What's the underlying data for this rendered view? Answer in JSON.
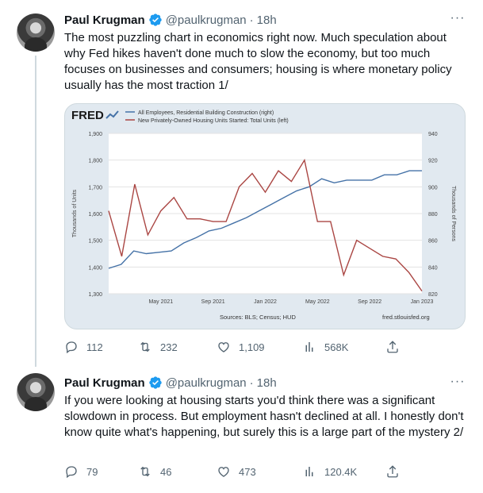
{
  "tweets": [
    {
      "author": {
        "name": "Paul Krugman",
        "handle": "@paulkrugman",
        "separator": "·",
        "time": "18h"
      },
      "text": "The most puzzling chart in economics right now. Much speculation about why Fed hikes haven't done much to slow the economy, but too much focuses on businesses and consumers; housing is where monetary policy usually has the most traction 1/",
      "more_icon": "···",
      "stats": {
        "replies": "112",
        "retweets": "232",
        "likes": "1,109",
        "views": "568K"
      }
    },
    {
      "author": {
        "name": "Paul Krugman",
        "handle": "@paulkrugman",
        "separator": "·",
        "time": "18h"
      },
      "text": "If you were looking at housing starts you'd think there was a significant slowdown in process. But employment hasn't declined at all. I honestly don't know quite what's happening, but surely this is a large part of the mystery 2/",
      "more_icon": "···",
      "stats": {
        "replies": "79",
        "retweets": "46",
        "likes": "473",
        "views": "120.4K"
      }
    }
  ],
  "icons": [
    "verified-badge-icon",
    "more-icon",
    "reply-icon",
    "retweet-icon",
    "like-icon",
    "views-icon",
    "share-icon"
  ],
  "colors": {
    "verified": "#1d9bf0",
    "text": "#0f1419",
    "muted": "#536471",
    "fred_blue": "#4572a7",
    "fred_red": "#aa4643",
    "chart_bg": "#e1e9f0"
  },
  "chart_data": {
    "type": "line",
    "logo": "FRED",
    "legend": [
      "All Employees, Residential Building Construction (right)",
      "New Privately-Owned Housing Units Started: Total Units (left)"
    ],
    "ylabel_left": "Thousands of Units",
    "ylabel_right": "Thousands of Persons",
    "ylim_left": [
      1300,
      1900
    ],
    "ylim_right": [
      820,
      940
    ],
    "yticks_left": [
      "1,900",
      "1,800",
      "1,700",
      "1,600",
      "1,500",
      "1,400",
      "1,300"
    ],
    "yticks_right": [
      "940",
      "920",
      "900",
      "880",
      "860",
      "840",
      "820"
    ],
    "xticks": [
      "May 2021",
      "Sep 2021",
      "Jan 2022",
      "May 2022",
      "Sep 2022",
      "Jan 2023"
    ],
    "x_months": 24,
    "source": "Sources: BLS; Census; HUD",
    "site": "fred.stlouisfed.org",
    "series": [
      {
        "name": "All Employees, Residential Building Construction (right)",
        "axis": "right",
        "color": "#4572a7",
        "values": [
          839,
          842,
          852,
          850,
          851,
          852,
          858,
          862,
          867,
          869,
          873,
          877,
          882,
          887,
          892,
          897,
          900,
          906,
          903,
          905,
          905,
          905,
          909,
          909,
          912,
          912
        ]
      },
      {
        "name": "New Privately-Owned Housing Units Started: Total Units (left)",
        "axis": "left",
        "color": "#aa4643",
        "values": [
          1610,
          1440,
          1710,
          1520,
          1610,
          1660,
          1580,
          1580,
          1570,
          1570,
          1700,
          1750,
          1680,
          1760,
          1720,
          1800,
          1570,
          1570,
          1370,
          1500,
          1470,
          1440,
          1430,
          1380,
          1310
        ]
      }
    ]
  }
}
